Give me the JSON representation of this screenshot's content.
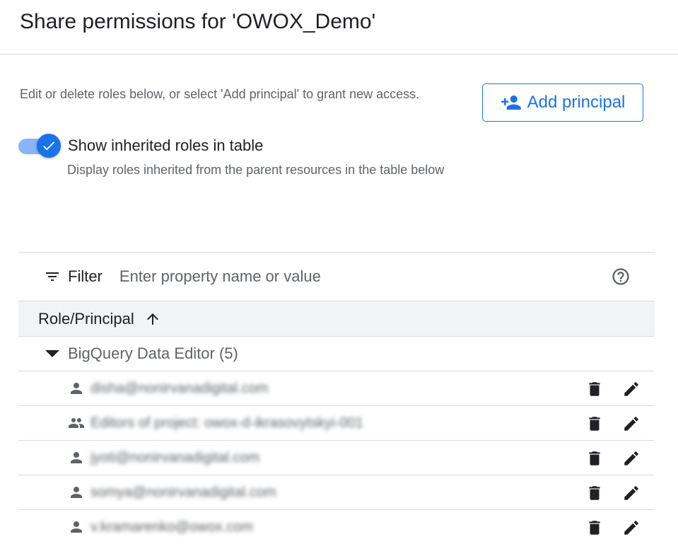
{
  "header": {
    "title": "Share permissions for 'OWOX_Demo'"
  },
  "intro": {
    "description": "Edit or delete roles below, or select 'Add principal' to grant new access.",
    "add_principal_label": "Add principal"
  },
  "inherited_toggle": {
    "label": "Show inherited roles in table",
    "sublabel": "Display roles inherited from the parent resources in the table below",
    "checked": true
  },
  "filter": {
    "label": "Filter",
    "placeholder": "Enter property name or value"
  },
  "table": {
    "column_header": "Role/Principal",
    "group": {
      "label": "BigQuery Data Editor (5)"
    },
    "rows": [
      {
        "principal": "disha@nonirvanadigital.com",
        "icon": "person-icon"
      },
      {
        "principal": "Editors of project: owox-d-ikrasovytskyi-001",
        "icon": "group-icon"
      },
      {
        "principal": "jyoti@nonirvanadigital.com",
        "icon": "person-icon"
      },
      {
        "principal": "somya@nonirvanadigital.com",
        "icon": "person-icon"
      },
      {
        "principal": "v.kramarenko@owox.com",
        "icon": "person-icon"
      }
    ]
  },
  "colors": {
    "accent": "#1a73e8",
    "toggle_track": "#8ab4f8",
    "header_bg": "#f1f3f4"
  }
}
